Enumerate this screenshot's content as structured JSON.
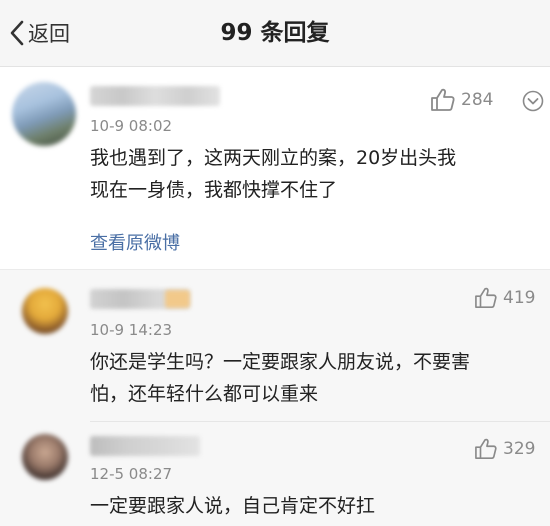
{
  "header": {
    "back_label": "返回",
    "title_count": "99",
    "title_suffix": "条回复"
  },
  "main_comment": {
    "timestamp": "10-9 08:02",
    "likes": "284",
    "text_line1": "我也遇到了，这两天刚立的案，20岁出头我",
    "text_line2": "现在一身债，我都快撑不住了",
    "view_original": "查看原微博"
  },
  "replies": [
    {
      "timestamp": "10-9 14:23",
      "likes": "419",
      "text_line1": "你还是学生吗？一定要跟家人朋友说，不要害",
      "text_line2": "怕，还年轻什么都可以重来"
    },
    {
      "timestamp": "12-5 08:27",
      "likes": "329",
      "text_line1": "一定要跟家人说，自己肯定不好扛"
    }
  ],
  "icons": {
    "back": "chevron-left-icon",
    "like": "thumbs-up-icon",
    "more": "chevron-down-circle-icon"
  }
}
